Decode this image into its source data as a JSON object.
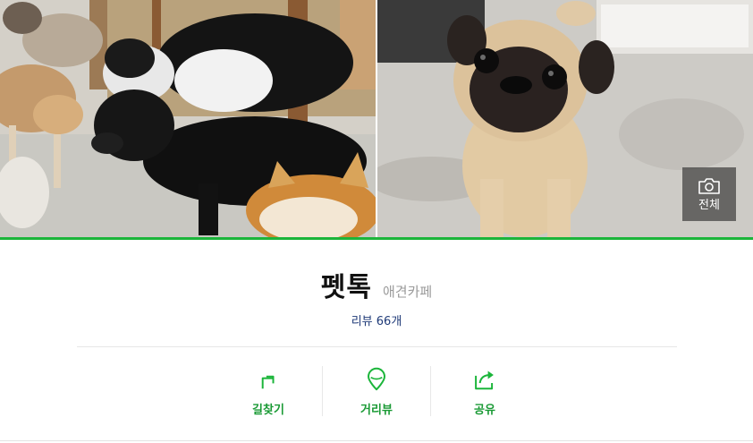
{
  "header": {
    "view_all_label": "전체"
  },
  "place": {
    "name": "펫톡",
    "category": "애견카페",
    "reviews_label": "리뷰 66개"
  },
  "actions": [
    {
      "label": "길찾기",
      "icon": "directions-icon"
    },
    {
      "label": "거리뷰",
      "icon": "map-pin-icon"
    },
    {
      "label": "공유",
      "icon": "share-icon"
    }
  ],
  "colors": {
    "accent": "#1bb53a",
    "action_text": "#1a9a35",
    "review_link": "#1f3a78"
  }
}
